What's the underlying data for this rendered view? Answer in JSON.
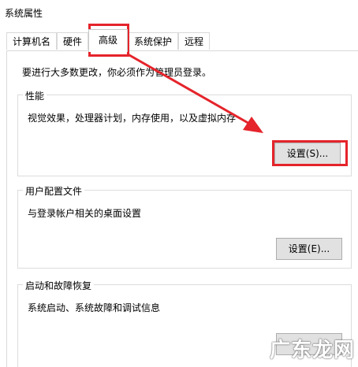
{
  "window": {
    "title": "系统属性"
  },
  "tabs": [
    {
      "label": "计算机名"
    },
    {
      "label": "硬件"
    },
    {
      "label": "高级"
    },
    {
      "label": "系统保护"
    },
    {
      "label": "远程"
    }
  ],
  "notice": "要进行大多数更改，你必须作为管理员登录。",
  "groups": {
    "performance": {
      "title": "性能",
      "desc": "视觉效果，处理器计划，内存使用，以及虚拟内存",
      "button": "设置(S)..."
    },
    "profile": {
      "title": "用户配置文件",
      "desc": "与登录帐户相关的桌面设置",
      "button": "设置(E)..."
    },
    "startup": {
      "title": "启动和故障恢复",
      "desc": "系统启动、系统故障和调试信息",
      "button": ""
    }
  },
  "watermark": "广东龙网",
  "colors": {
    "highlight": "#e5242b",
    "button_bg": "#e1e1e1"
  }
}
